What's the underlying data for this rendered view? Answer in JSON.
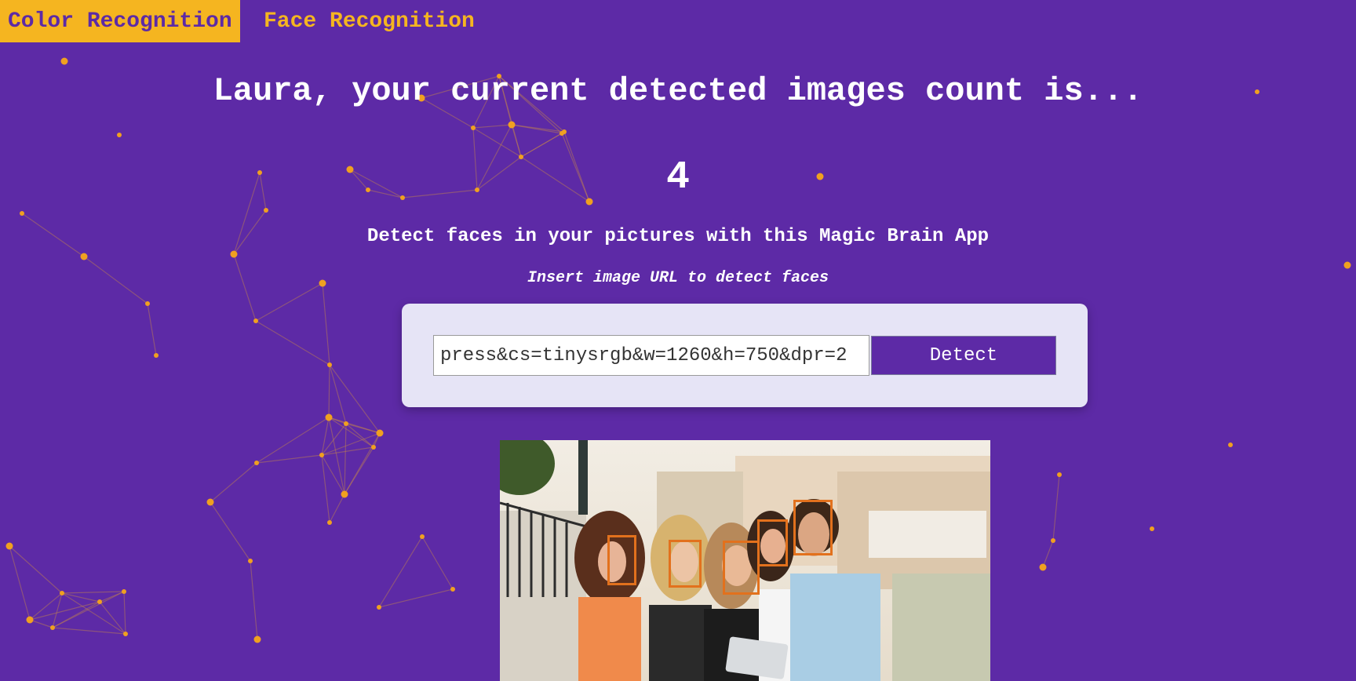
{
  "nav": {
    "color_recognition": "Color Recognition",
    "face_recognition": "Face Recognition"
  },
  "greeting": "Laura, your current detected images count is...",
  "count": "4",
  "tagline": "Detect faces in your pictures with this Magic Brain App",
  "instruction": "Insert image URL to detect faces",
  "form": {
    "input_value": "press&cs=tinysrgb&w=1260&h=750&dpr=2",
    "button_label": "Detect"
  },
  "colors": {
    "background": "#5d2aa6",
    "accent": "#f5b520",
    "card": "#e6e4f6",
    "face_box": "#e2711d"
  },
  "detected_faces_shown": 5
}
